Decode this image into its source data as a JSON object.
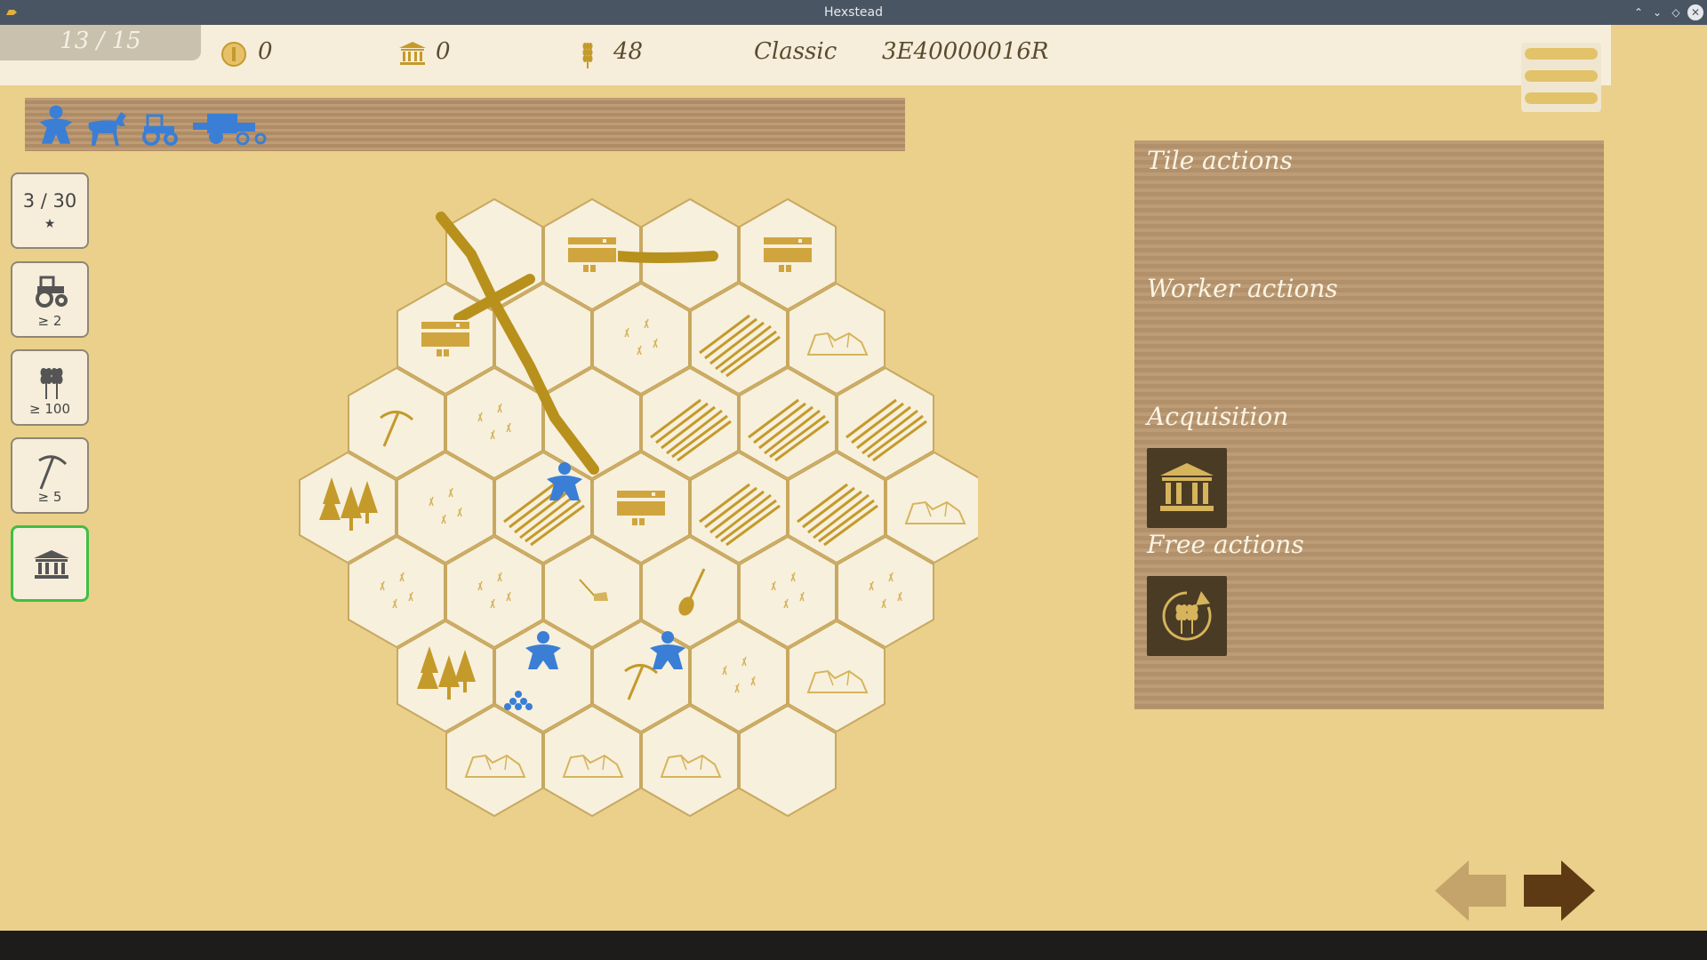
{
  "window": {
    "title": "Hexstead"
  },
  "topbar": {
    "round": "13 / 15",
    "coins": "0",
    "museum": "0",
    "grain": "48",
    "mode": "Classic",
    "seed": "3E40000016R"
  },
  "workers": [
    "worker-meeple",
    "horse",
    "tractor",
    "harvester"
  ],
  "sidebar": {
    "score": "3 / 30",
    "score_star": "★",
    "goals": [
      {
        "icon": "tractor-icon",
        "label": "≥ 2"
      },
      {
        "icon": "wheat-icon",
        "label": "≥ 100"
      },
      {
        "icon": "pickaxe-icon",
        "label": "≥ 5"
      },
      {
        "icon": "museum-icon",
        "label": ""
      }
    ]
  },
  "panel": {
    "tile_actions": "Tile actions",
    "worker_actions": "Worker actions",
    "acquisition": "Acquisition",
    "free_actions": "Free actions",
    "acquisition_buttons": [
      "museum-icon"
    ],
    "free_buttons": [
      "harvest-cycle-icon"
    ]
  },
  "board": {
    "rows": [
      [
        "road",
        "house",
        "road",
        "house"
      ],
      [
        "house",
        "road",
        "meadow",
        "field",
        "rock"
      ],
      [
        "pickaxe",
        "meadow",
        "road",
        "field",
        "field",
        "field"
      ],
      [
        "forest",
        "meadow",
        "field+worker",
        "house",
        "field",
        "field",
        "rock"
      ],
      [
        "meadow",
        "meadow",
        "plough",
        "shovel",
        "meadow",
        "meadow"
      ],
      [
        "forest",
        "worker+berries",
        "pickaxe+worker",
        "meadow",
        "rock"
      ],
      [
        "rock",
        "rock",
        "rock",
        "empty"
      ]
    ]
  },
  "colors": {
    "accent": "#c49a2b",
    "worker": "#3a7fd5",
    "tile": "#f7f0dd",
    "panel": "#b8966e",
    "bg": "#ead08a"
  }
}
